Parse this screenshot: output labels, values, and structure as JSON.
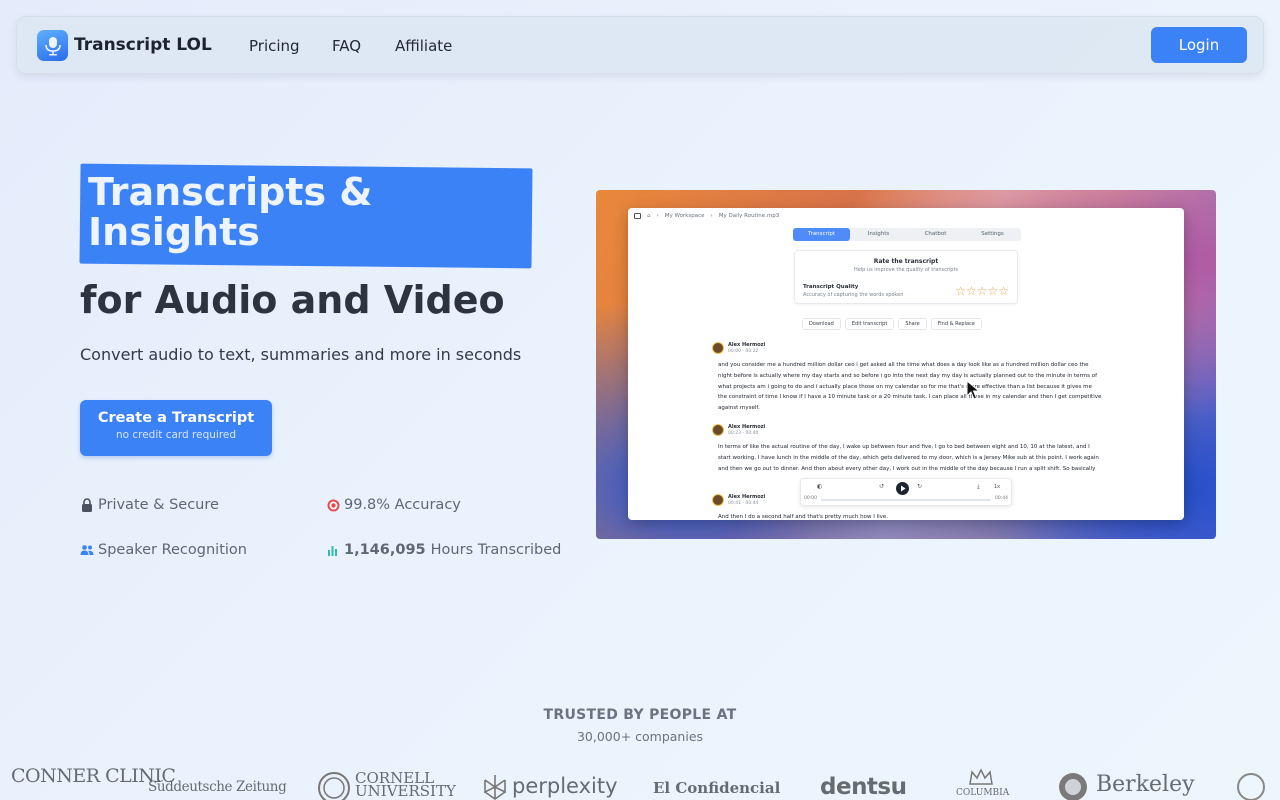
{
  "nav": {
    "brand": "Transcript LOL",
    "links": [
      "Pricing",
      "FAQ",
      "Affiliate"
    ],
    "login": "Login"
  },
  "hero": {
    "highlight": "Transcripts & Insights",
    "subtitle": "for Audio and Video",
    "description": "Convert audio to text, summaries and more in seconds",
    "cta_label": "Create a Transcript",
    "cta_note": "no credit card required",
    "features": {
      "private": "Private & Secure",
      "accuracy": "99.8% Accuracy",
      "speaker": "Speaker Recognition",
      "hours_count": "1,146,095",
      "hours_label": "Hours Transcribed"
    }
  },
  "preview": {
    "breadcrumb": [
      "My Workspace",
      "My Daily Routine.mp3"
    ],
    "tabs": [
      "Transcript",
      "Insights",
      "Chatbot",
      "Settings"
    ],
    "active_tab": "Transcript",
    "rating": {
      "title": "Rate the transcript",
      "help": "Help us improve the quality of transcripts",
      "quality_label": "Transcript Quality",
      "quality_desc": "Accuracy of capturing the words spoken",
      "stars": "☆☆☆☆☆"
    },
    "tools": [
      "Download",
      "Edit transcript",
      "Share",
      "Find & Replace"
    ],
    "segments": [
      {
        "speaker": "Alex Hermozi",
        "time": "00:00 - 00:22",
        "text": "and you consider me a hundred million dollar ceo i get asked all the time what does a day look like as a hundred million dollar ceo the night before is actually where my day starts and so before i go into the next day my day is actually planned out to the minute in terms of what projects am i going to do and i actually place those on my calendar so for me that's more effective than a list because it gives me the constraint of time I know if I have a 10 minute task or a 20 minute task, I can place all those in my calendar and then I get competitive against myself."
      },
      {
        "speaker": "Alex Hermozi",
        "time": "00:23 - 00:40",
        "text": "In terms of like the actual routine of the day, I wake up between four and five, I go to bed between eight and 10, 10 at the latest, and I start working. I have lunch in the middle of the day, which gets delivered to my door, which is a Jersey Mike sub at this point. I work again and then we go out to dinner. And then about every other day, I work out in the middle of the day because I run a split shift. So basically"
      },
      {
        "speaker": "Alex Hermozi",
        "time": "00:41 - 00:44",
        "text": "And then I do a second half and that's pretty much how I live."
      }
    ],
    "player": {
      "start": "00:00",
      "end": "00:44",
      "speed": "1x"
    }
  },
  "trusted": {
    "title": "TRUSTED BY PEOPLE AT",
    "sub": "30,000+ companies",
    "logos": [
      "CONNER CLINIC",
      "Süddeutsche Zeitung",
      "CORNELL UNIVERSITY",
      "perplexity",
      "El Confidencial",
      "dentsu",
      "COLUMBIA",
      "Berkeley"
    ]
  }
}
